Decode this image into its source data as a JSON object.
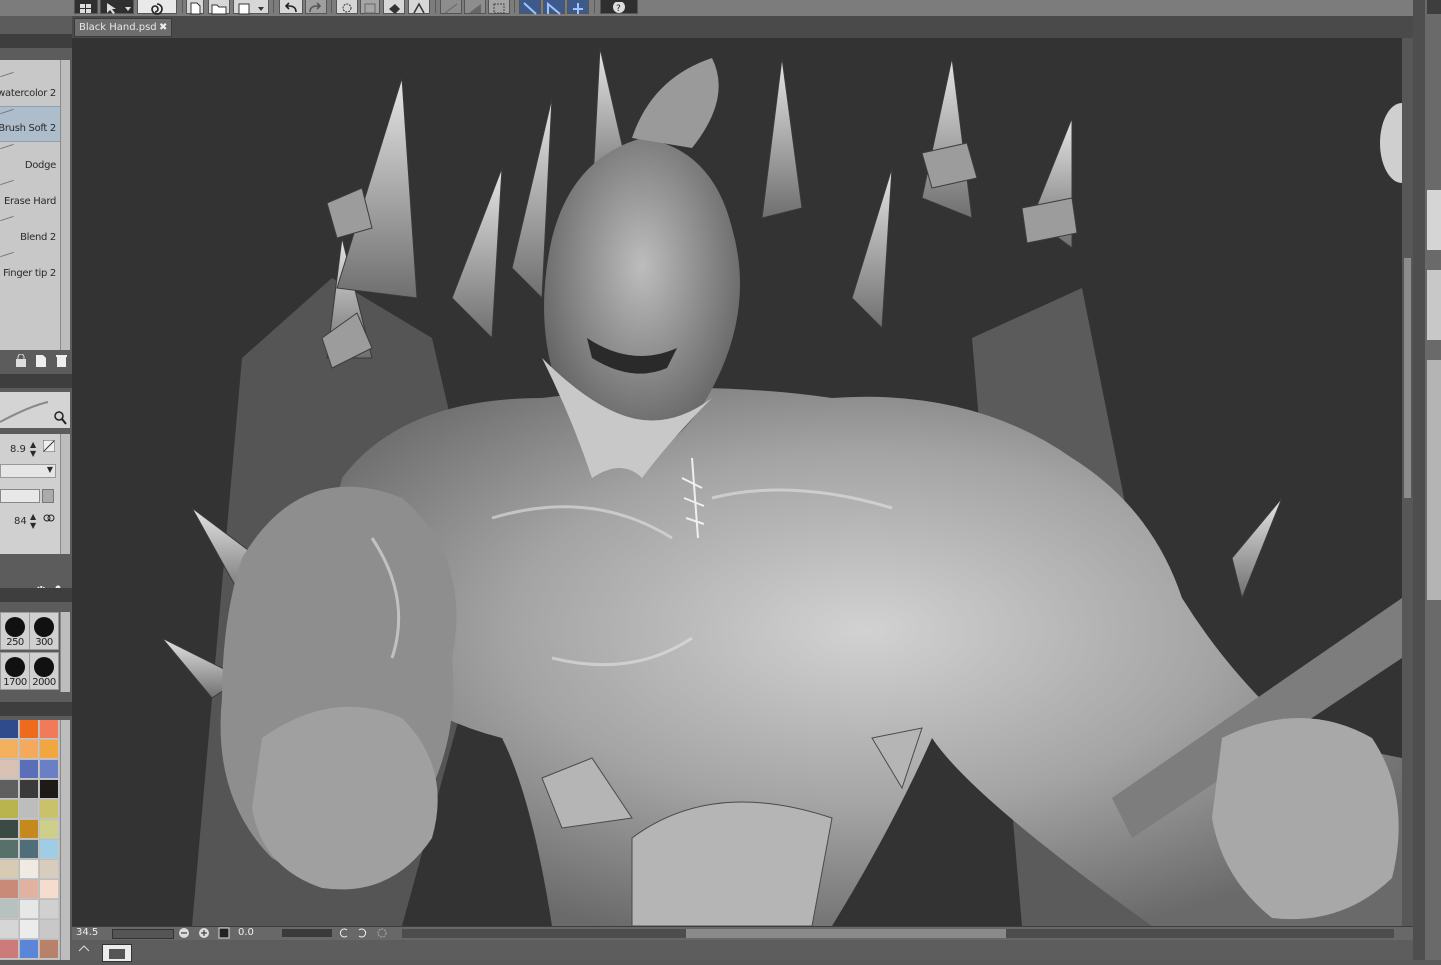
{
  "document": {
    "tab_label": "Black Hand.psd",
    "close_symbol": "✖"
  },
  "brushes": {
    "items": [
      {
        "label": "watercolor 2",
        "selected": false
      },
      {
        "label": "Brush Soft 2",
        "selected": true
      },
      {
        "label": "Dodge",
        "selected": false
      },
      {
        "label": "Erase Hard",
        "selected": false
      },
      {
        "label": "Blend 2",
        "selected": false
      },
      {
        "label": "Finger tip 2",
        "selected": false
      }
    ]
  },
  "tool_property": {
    "brush_size": "8.9",
    "opacity": "84"
  },
  "brush_sizes": [
    "250",
    "300",
    "1700",
    "2000"
  ],
  "palette": {
    "colors": [
      "#2f4b8c",
      "#ee6a1c",
      "#f07a5a",
      "#f3b15e",
      "#f5a95c",
      "#f2a640",
      "#d9c2b4",
      "#5a6fb8",
      "#6b7fc4",
      "#5f5f5f",
      "#3a3a3a",
      "#1e1a17",
      "#b9b44e",
      "#bdbdbd",
      "#c9c26a",
      "#3c4a44",
      "#c48a1e",
      "#cfcf8c",
      "#58706a",
      "#4f6e7a",
      "#9fcde3",
      "#d7cbb4",
      "#f0ebe2",
      "#d8ccbc",
      "#c98a78",
      "#e2b2a0",
      "#f6dccc",
      "#b7c2c0",
      "#e7e7e7",
      "#d0d0d0",
      "#d6d6d6",
      "#ececec",
      "#c8c8c8",
      "#cc7a7a",
      "#5b85d6",
      "#b8826a"
    ]
  },
  "status": {
    "zoom": "34.5",
    "rotation": "0.0"
  },
  "colors": {
    "canvas_bg": "#333333",
    "selection": "#aebdcc",
    "accent_blue": "#3d5a8a"
  }
}
